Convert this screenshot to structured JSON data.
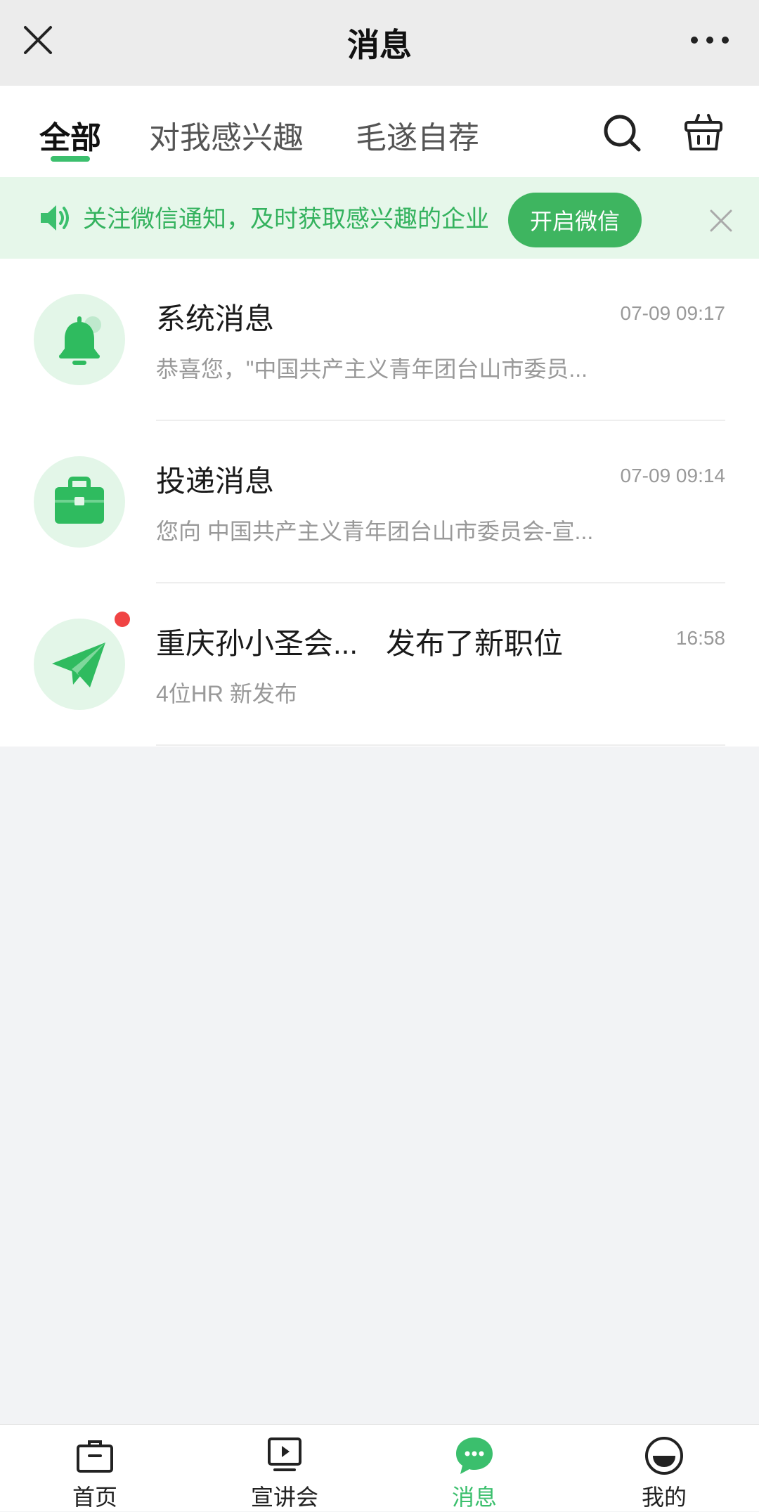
{
  "titlebar": {
    "title": "消息"
  },
  "tabs": {
    "items": [
      {
        "label": "全部",
        "active": true
      },
      {
        "label": "对我感兴趣",
        "active": false
      },
      {
        "label": "毛遂自荐",
        "active": false
      }
    ],
    "icons": [
      "search-icon",
      "basket-icon"
    ]
  },
  "notice": {
    "text": "关注微信通知，及时获取感兴趣的企业",
    "button": "开启微信"
  },
  "messages": [
    {
      "title": "系统消息",
      "time": "07-09 09:17",
      "preview": "恭喜您，\"中国共产主义青年团台山市委员...",
      "icon": "bell-icon",
      "unread": false
    },
    {
      "title": "投递消息",
      "time": "07-09 09:14",
      "preview": "您向 中国共产主义青年团台山市委员会-宣...",
      "icon": "briefcase-icon",
      "unread": false
    },
    {
      "title": "重庆孙小圣会...",
      "title_suffix": "发布了新职位",
      "time": "16:58",
      "preview": "4位HR 新发布",
      "icon": "paper-plane-icon",
      "unread": true
    }
  ],
  "bottomnav": {
    "items": [
      {
        "label": "首页",
        "icon": "home-briefcase-icon",
        "active": false
      },
      {
        "label": "宣讲会",
        "icon": "presentation-icon",
        "active": false
      },
      {
        "label": "消息",
        "icon": "message-bubble-icon",
        "active": true
      },
      {
        "label": "我的",
        "icon": "profile-face-icon",
        "active": false
      }
    ]
  },
  "colors": {
    "accent": "#3bbf6d",
    "notice_bg": "#e6f7ea",
    "unread": "#f04444"
  }
}
